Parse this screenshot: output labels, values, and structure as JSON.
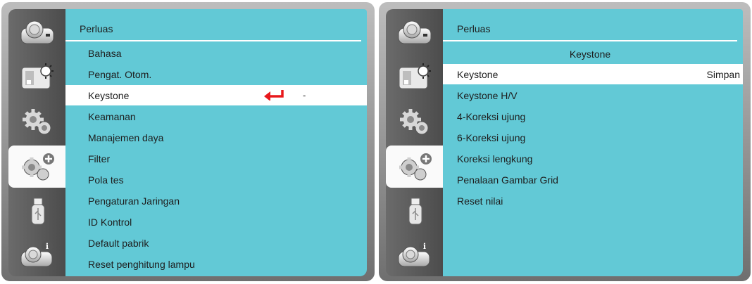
{
  "left_panel": {
    "title": "Perluas",
    "sidebar_icons": [
      "picture-icon",
      "display-brightness-icon",
      "gear-settings-icon",
      "gear-plus-expand-icon",
      "usb-icon",
      "camera-info-icon"
    ],
    "selected_sidebar_index": 3,
    "menu_items": [
      {
        "label": "Bahasa"
      },
      {
        "label": "Pengat. Otom."
      },
      {
        "label": "Keystone",
        "selected": true,
        "value": "-",
        "icon": "enter-arrow-icon"
      },
      {
        "label": "Keamanan"
      },
      {
        "label": "Manajemen daya"
      },
      {
        "label": "Filter"
      },
      {
        "label": "Pola tes"
      },
      {
        "label": "Pengaturan Jaringan"
      },
      {
        "label": "ID Kontrol"
      },
      {
        "label": "Default pabrik"
      },
      {
        "label": "Reset penghitung lampu"
      }
    ]
  },
  "right_panel": {
    "title": "Perluas",
    "subheader": "Keystone",
    "sidebar_icons": [
      "picture-icon",
      "display-brightness-icon",
      "gear-settings-icon",
      "gear-plus-expand-icon",
      "usb-icon",
      "camera-info-icon"
    ],
    "selected_sidebar_index": 3,
    "menu_items": [
      {
        "label": "Keystone",
        "selected": true,
        "value": "Simpan"
      },
      {
        "label": "Keystone H/V"
      },
      {
        "label": "4-Koreksi ujung"
      },
      {
        "label": "6-Koreksi ujung"
      },
      {
        "label": "Koreksi lengkung"
      },
      {
        "label": "Penalaan Gambar Grid"
      },
      {
        "label": "Reset nilai"
      }
    ]
  },
  "colors": {
    "content_bg": "#62c9d6",
    "selected_row": "#ffffff",
    "enter_arrow": "#e8191c"
  }
}
